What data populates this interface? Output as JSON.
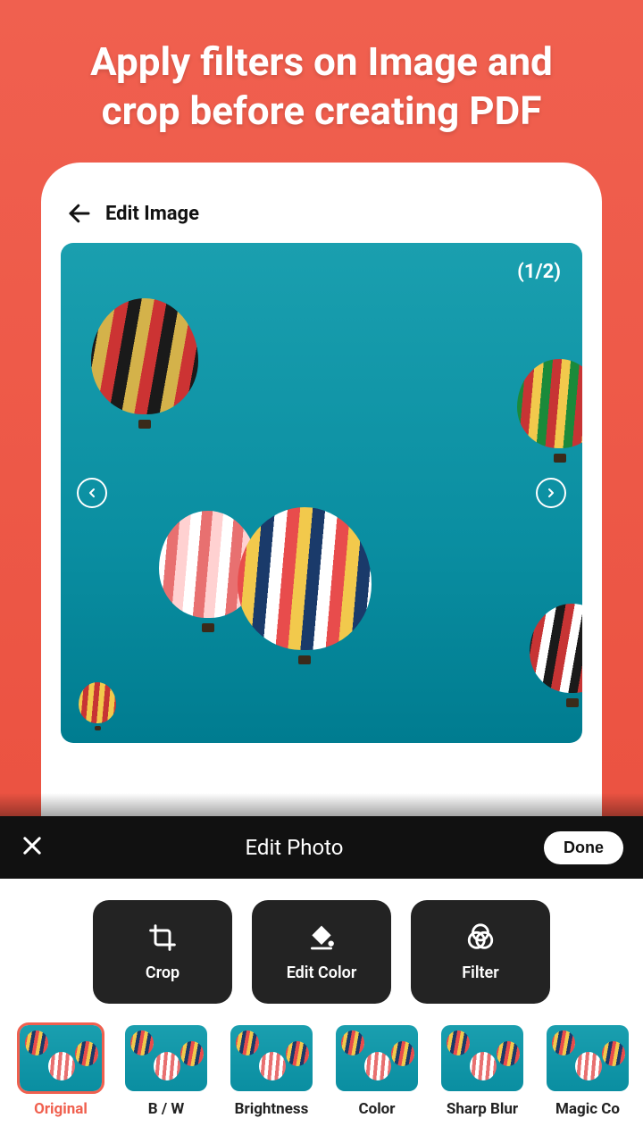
{
  "promo": {
    "line1": "Apply filters on Image and",
    "line2": "crop before creating PDF"
  },
  "header": {
    "title": "Edit Image"
  },
  "pager": {
    "text": "(1/2)"
  },
  "sheet": {
    "title": "Edit Photo",
    "done": "Done"
  },
  "tools": {
    "crop": "Crop",
    "edit_color": "Edit Color",
    "filter": "Filter"
  },
  "filters": [
    {
      "label": "Original",
      "selected": true
    },
    {
      "label": "B / W",
      "selected": false
    },
    {
      "label": "Brightness",
      "selected": false
    },
    {
      "label": "Color",
      "selected": false
    },
    {
      "label": "Sharp Blur",
      "selected": false
    },
    {
      "label": "Magic Co",
      "selected": false
    }
  ]
}
